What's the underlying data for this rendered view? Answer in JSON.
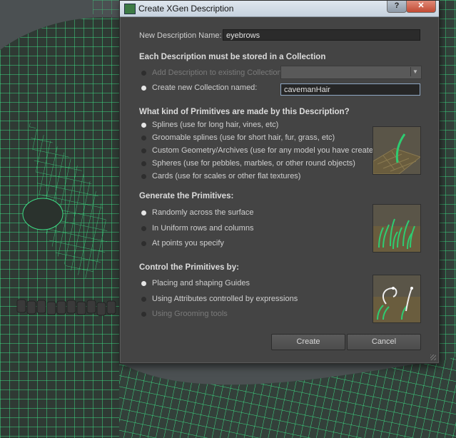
{
  "window": {
    "title": "Create XGen Description",
    "help_label": "?",
    "close_label": "✕"
  },
  "name_row": {
    "label": "New Description Name:",
    "value": "eyebrows"
  },
  "collection": {
    "header": "Each Description must be stored in a Collection",
    "existing_label": "Add Description to existing Collection:",
    "new_label": "Create new Collection named:",
    "new_value": "cavemanHair"
  },
  "primitives": {
    "header": "What kind of Primitives are made by this Description?",
    "options": [
      "Splines (use for long hair, vines, etc)",
      "Groomable splines (use for short hair, fur, grass, etc)",
      "Custom Geometry/Archives (use for any model you have created)",
      "Spheres (use for pebbles, marbles, or other round objects)",
      "Cards (use for scales or other flat textures)"
    ]
  },
  "generate": {
    "header": "Generate the Primitives:",
    "options": [
      "Randomly across the surface",
      "In Uniform rows and columns",
      "At points you specify"
    ]
  },
  "control": {
    "header": "Control the Primitives by:",
    "options": [
      "Placing and shaping Guides",
      "Using Attributes controlled by expressions",
      "Using Grooming tools"
    ]
  },
  "buttons": {
    "create": "Create",
    "cancel": "Cancel"
  },
  "colors": {
    "wireframe": "#3ddc84",
    "dialog_bg": "#444444",
    "titlebar": "#d4dde8"
  }
}
